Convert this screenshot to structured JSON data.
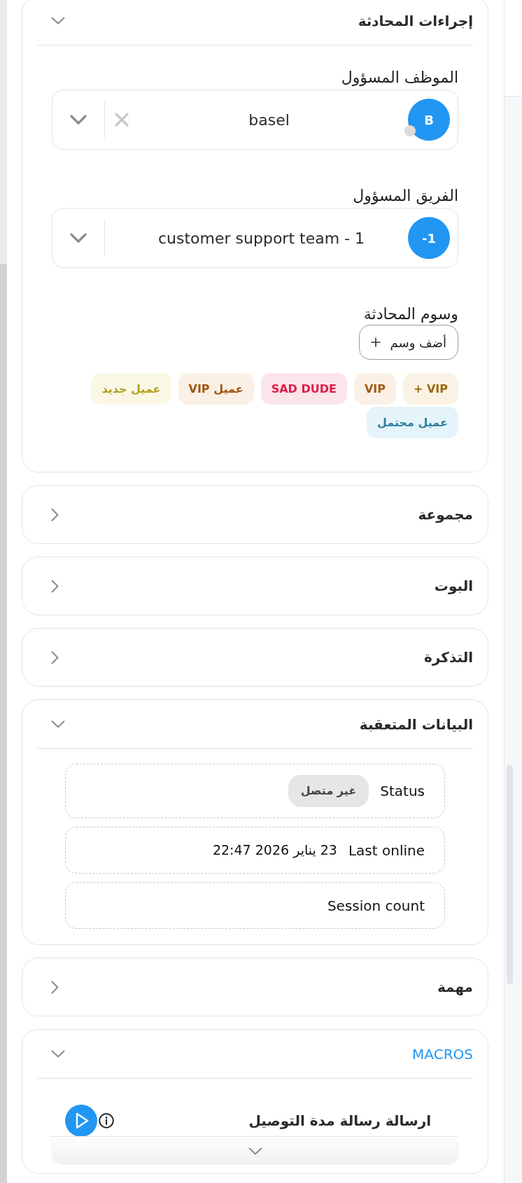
{
  "sections": [
    {
      "kind": "assignment",
      "title": "إجراءات المحادثة",
      "expanded": true,
      "fields": [
        {
          "label": "الموظف المسؤول",
          "avatar": "B",
          "value": "basel",
          "online": false,
          "clearable": true
        },
        {
          "label": "الفريق المسؤول",
          "avatar": "-1",
          "value": "customer support team - 1",
          "clearable": false
        }
      ],
      "tags": {
        "label": "وسوم المحادثة",
        "add_button": "أضف وسم",
        "items": [
          {
            "text": "+ VIP",
            "color": "#9a6b0c"
          },
          {
            "text": "VIP",
            "color": "#a35a12"
          },
          {
            "text": "SAD DUDE",
            "color": "#e11d48"
          },
          {
            "text": "عميل VIP",
            "color": "#9f560e"
          },
          {
            "text": "عميل جديد",
            "color": "#b3a01c"
          },
          {
            "text": "عميل محتمل",
            "color": "#2e7ea0"
          }
        ]
      }
    },
    {
      "kind": "collapsed",
      "title": "مجموعة",
      "expanded": false
    },
    {
      "kind": "collapsed",
      "title": "البوت",
      "expanded": false
    },
    {
      "kind": "collapsed",
      "title": "التذكرة",
      "expanded": false
    },
    {
      "kind": "tracked",
      "title": "البيانات المتعقبة",
      "expanded": true,
      "rows": [
        {
          "kind": "chip",
          "label": "Status",
          "value": "غير متصل"
        },
        {
          "kind": "text",
          "label": "Last online",
          "value": "23 يناير 2026 22:47"
        },
        {
          "kind": "text",
          "label": "Session count"
        }
      ]
    },
    {
      "kind": "collapsed",
      "title": "مهمة",
      "expanded": false
    },
    {
      "kind": "macros",
      "title": "MACROS",
      "expanded": true,
      "macros": [
        {
          "name": "ارسالة رسالة مدة التوصيل"
        }
      ]
    }
  ]
}
